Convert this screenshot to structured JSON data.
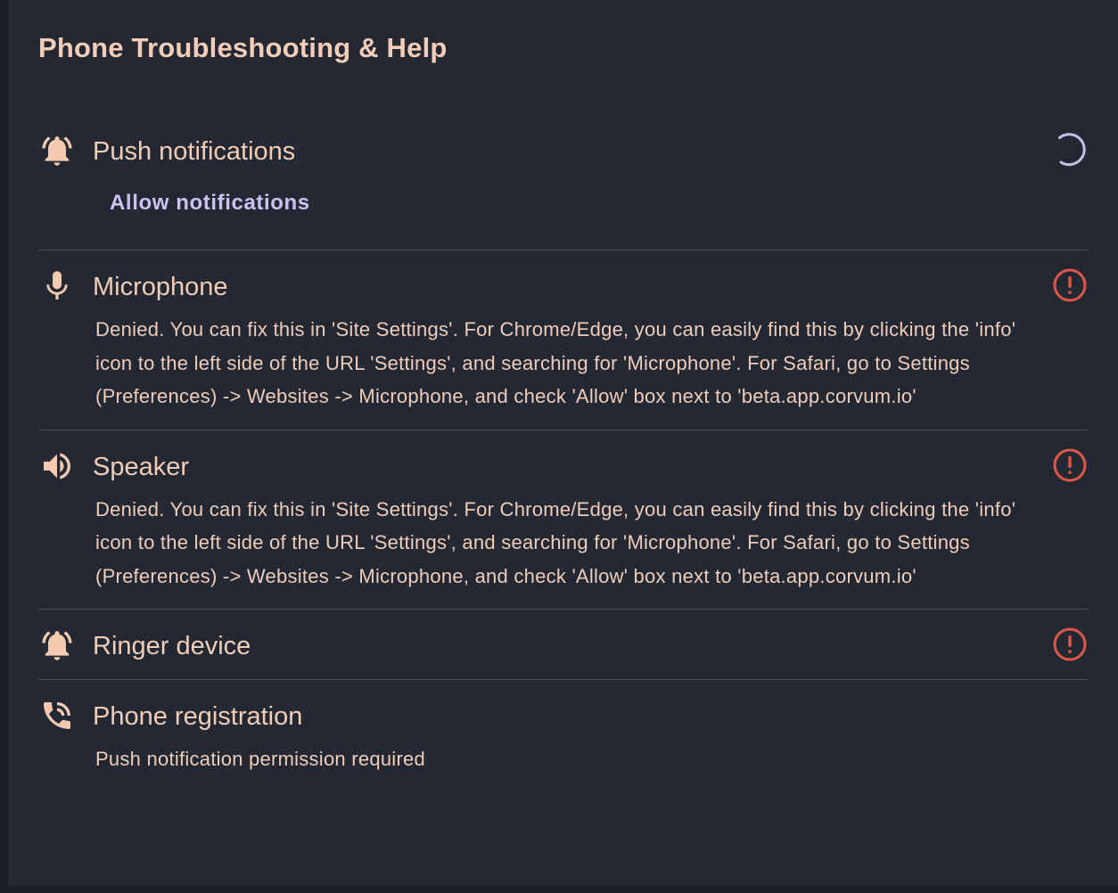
{
  "dialog": {
    "title": "Phone Troubleshooting & Help"
  },
  "items": {
    "push": {
      "label": "Push notifications",
      "icon": "bell-ring-icon",
      "status": "loading",
      "action_label": "Allow notifications"
    },
    "microphone": {
      "label": "Microphone",
      "icon": "microphone-icon",
      "status": "error",
      "description": "Denied. You can fix this in 'Site Settings'. For Chrome/Edge, you can easily find this by clicking the 'info' icon to the left side of the URL 'Settings', and searching for 'Microphone'. For Safari, go to Settings (Preferences) -> Websites -> Microphone, and check 'Allow' box next to 'beta.app.corvum.io'"
    },
    "speaker": {
      "label": "Speaker",
      "icon": "speaker-icon",
      "status": "error",
      "description": "Denied. You can fix this in 'Site Settings'. For Chrome/Edge, you can easily find this by clicking the 'info' icon to the left side of the URL 'Settings', and searching for 'Microphone'. For Safari, go to Settings (Preferences) -> Websites -> Microphone, and check 'Allow' box next to 'beta.app.corvum.io'"
    },
    "ringer": {
      "label": "Ringer device",
      "icon": "bell-ring-icon",
      "status": "error"
    },
    "phone": {
      "label": "Phone registration",
      "icon": "phone-callback-icon",
      "description": "Push notification permission required"
    }
  },
  "colors": {
    "background": "#232833",
    "text": "#f1cdb8",
    "link": "#cbc2f0",
    "error": "#e0574a",
    "divider": "#4a505c"
  }
}
